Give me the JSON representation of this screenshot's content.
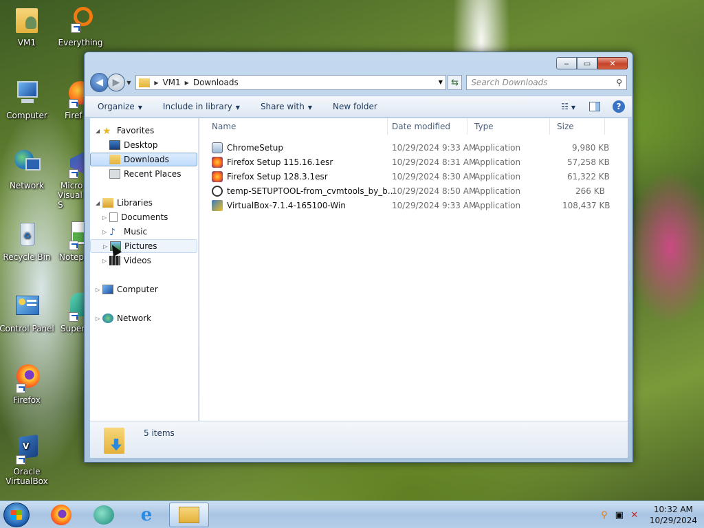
{
  "desktop": {
    "icons": [
      {
        "label": "VM1"
      },
      {
        "label": "Everything"
      },
      {
        "label": "Computer"
      },
      {
        "label": "Firef"
      },
      {
        "label": "Network"
      },
      {
        "label": "Micro"
      },
      {
        "label": "Visual S"
      },
      {
        "label": "Recycle Bin"
      },
      {
        "label": "Notepa"
      },
      {
        "label": "Control Panel"
      },
      {
        "label": "Super"
      },
      {
        "label": "Firefox"
      },
      {
        "label": "Oracle"
      },
      {
        "label": "VirtualBox"
      }
    ]
  },
  "window": {
    "caption": {
      "minimize": "‒",
      "maximize": "▭",
      "close": "✕"
    },
    "address": {
      "crumbs": [
        "VM1",
        "Downloads"
      ]
    },
    "search": {
      "placeholder": "Search Downloads"
    },
    "toolbar": {
      "organize": "Organize",
      "include_library": "Include in library",
      "share_with": "Share with",
      "new_folder": "New folder",
      "help": "?"
    },
    "nav": {
      "favorites": "Favorites",
      "desktop": "Desktop",
      "downloads": "Downloads",
      "recent_places": "Recent Places",
      "libraries": "Libraries",
      "documents": "Documents",
      "music": "Music",
      "pictures": "Pictures",
      "videos": "Videos",
      "computer": "Computer",
      "network": "Network"
    },
    "columns": {
      "name": "Name",
      "date": "Date modified",
      "type": "Type",
      "size": "Size"
    },
    "files": [
      {
        "name": "ChromeSetup",
        "date": "10/29/2024 9:33 AM",
        "type": "Application",
        "size": "9,980 KB"
      },
      {
        "name": "Firefox Setup 115.16.1esr",
        "date": "10/29/2024 8:31 AM",
        "type": "Application",
        "size": "57,258 KB"
      },
      {
        "name": "Firefox Setup 128.3.1esr",
        "date": "10/29/2024 8:30 AM",
        "type": "Application",
        "size": "61,322 KB"
      },
      {
        "name": "temp-SETUPTOOL-from_cvmtools_by_b...",
        "date": "10/29/2024 8:50 AM",
        "type": "Application",
        "size": "266 KB"
      },
      {
        "name": "VirtualBox-7.1.4-165100-Win",
        "date": "10/29/2024 9:33 AM",
        "type": "Application",
        "size": "108,437 KB"
      }
    ],
    "status": {
      "count": "5 items"
    }
  },
  "taskbar": {
    "clock": {
      "time": "10:32 AM",
      "date": "10/29/2024"
    }
  }
}
